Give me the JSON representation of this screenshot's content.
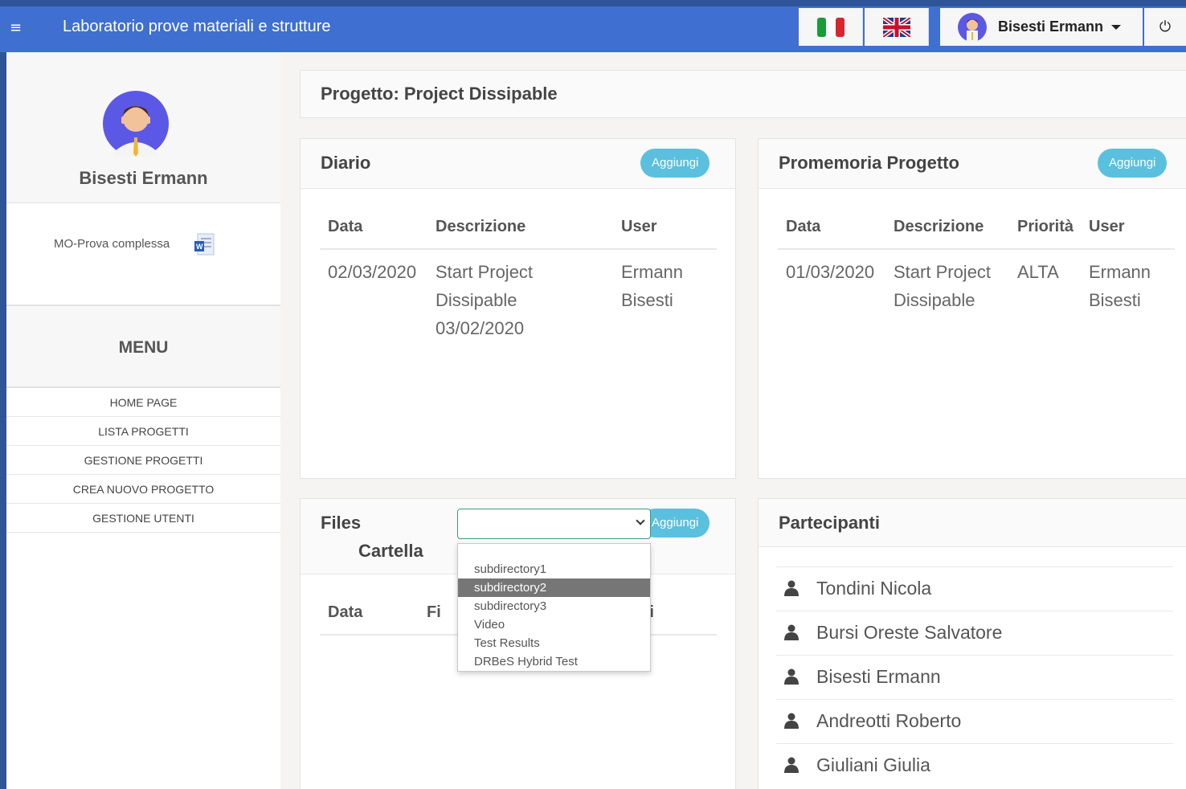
{
  "topbar": {
    "menu_icon": "hamburger-icon",
    "title": "Laboratorio prove materiali e strutture",
    "user_name": "Bisesti Ermann",
    "power_icon": "power-icon"
  },
  "sidebar": {
    "profile_name": "Bisesti Ermann",
    "document_label": "MO-Prova complessa",
    "menu_title": "MENU",
    "menu_items": [
      {
        "label": "HOME PAGE"
      },
      {
        "label": "LISTA PROGETTI"
      },
      {
        "label": "GESTIONE PROGETTI"
      },
      {
        "label": "CREA NUOVO PROGETTO"
      },
      {
        "label": "GESTIONE UTENTI"
      }
    ]
  },
  "project": {
    "title": "Progetto: Project Dissipable"
  },
  "diario": {
    "title": "Diario",
    "add_label": "Aggiungi",
    "columns": [
      "Data",
      "Descrizione",
      "User"
    ],
    "rows": [
      {
        "data": "02/03/2020",
        "descrizione": [
          "Start Project",
          "Dissipable",
          "03/02/2020"
        ],
        "user": [
          "Ermann",
          "Bisesti"
        ]
      }
    ]
  },
  "promemoria": {
    "title": "Promemoria Progetto",
    "add_label": "Aggiungi",
    "columns": [
      "Data",
      "Descrizione",
      "Priorità",
      "User"
    ],
    "rows": [
      {
        "data": "01/03/2020",
        "descrizione": [
          "Start Project",
          "Dissipable"
        ],
        "priorita": "ALTA",
        "user": [
          "Ermann",
          "Bisesti"
        ]
      }
    ]
  },
  "files": {
    "title": "Files",
    "folder_label": "Cartella",
    "add_label": "Aggiungi",
    "select_value": "",
    "dropdown_options": [
      "subdirectory1",
      "subdirectory2",
      "subdirectory3",
      "Video",
      "Test Results",
      "DRBeS Hybrid Test"
    ],
    "selected_option": "subdirectory2",
    "columns_visible": [
      "Data",
      "Fi",
      "oni"
    ]
  },
  "partecipanti": {
    "title": "Partecipanti",
    "members": [
      "Tondini Nicola",
      "Bursi Oreste Salvatore",
      "Bisesti Ermann",
      "Andreotti Roberto",
      "Giuliani Giulia"
    ]
  },
  "colors": {
    "topbar": "#3f6fd1",
    "frame": "#2e5597",
    "accent_button": "#5bc0de",
    "selected_option_bg": "#767676"
  }
}
